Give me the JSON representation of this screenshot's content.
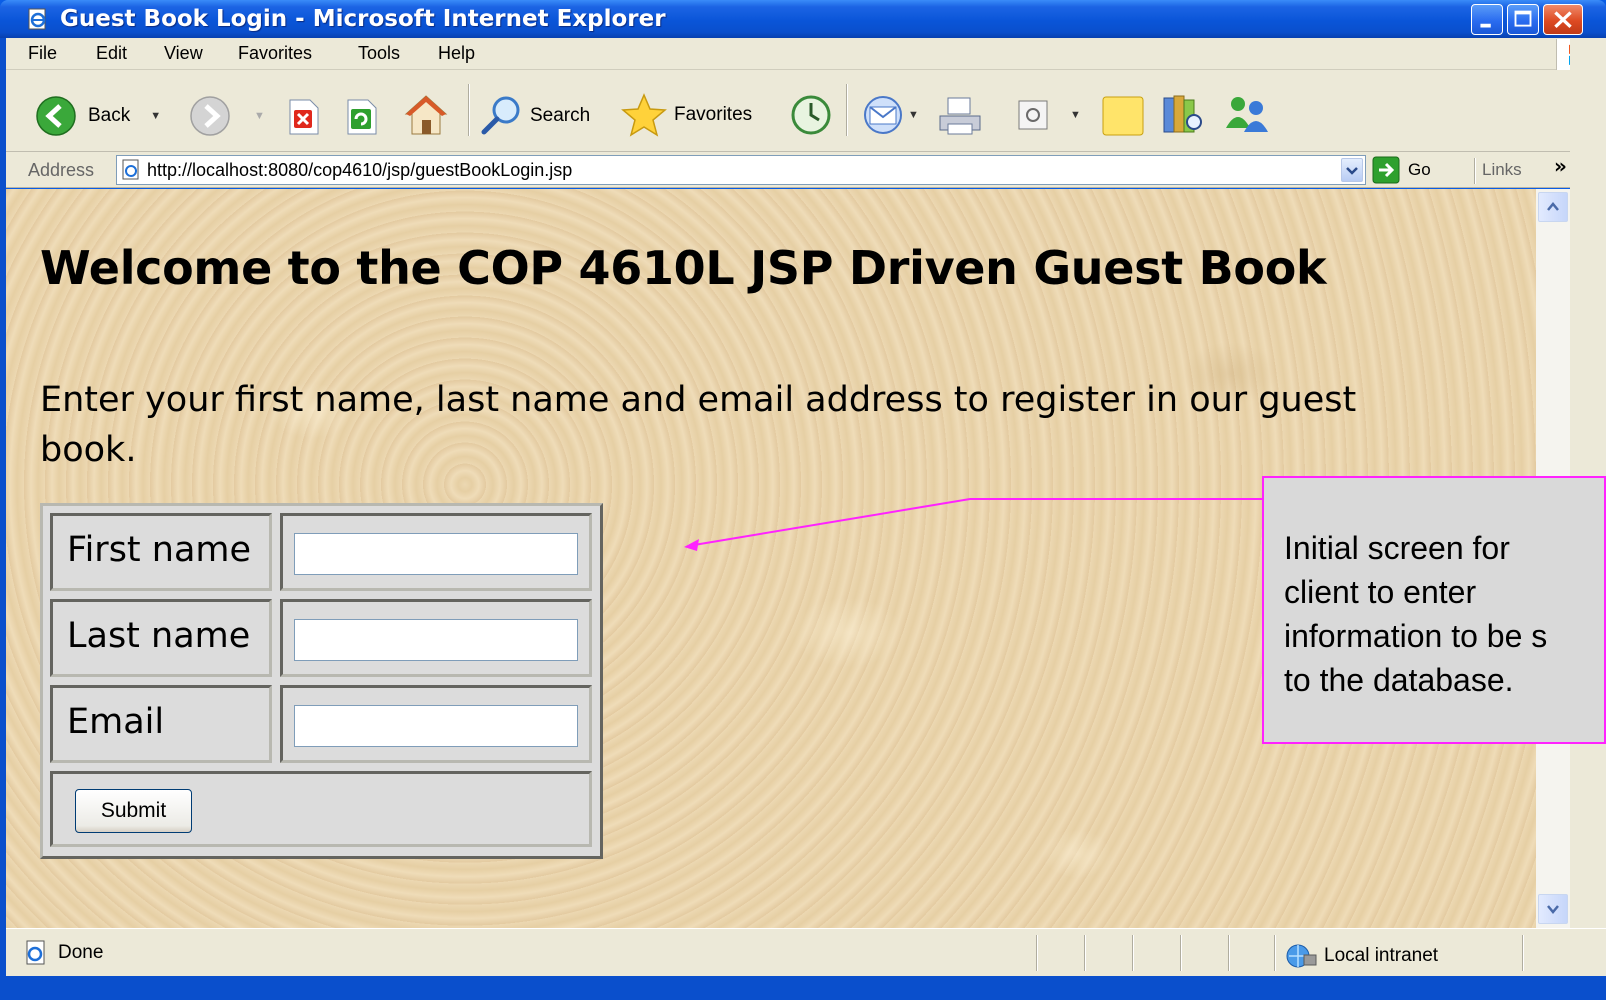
{
  "window": {
    "title": "Guest Book Login - Microsoft Internet Explorer",
    "accent": "#0a55d8"
  },
  "menu": {
    "items": [
      "File",
      "Edit",
      "View",
      "Favorites",
      "Tools",
      "Help"
    ]
  },
  "toolbar": {
    "back_label": "Back",
    "search_label": "Search",
    "favorites_label": "Favorites"
  },
  "address": {
    "label": "Address",
    "url": "http://localhost:8080/cop4610/jsp/guestBookLogin.jsp",
    "go_label": "Go",
    "links_label": "Links",
    "links_chevron": "»"
  },
  "page": {
    "heading": "Welcome to the COP 4610L JSP Driven Guest Book",
    "intro_line1": "Enter your first name, last name and email address to register in our guest",
    "intro_line2": "book.",
    "form": {
      "first_name_label": "First name",
      "first_name_value": "",
      "last_name_label": "Last name",
      "last_name_value": "",
      "email_label": "Email",
      "email_value": "",
      "submit_label": "Submit"
    }
  },
  "status": {
    "text": "Done",
    "zone": "Local intranet"
  },
  "callout": {
    "lines": [
      "Initial screen for",
      "client to enter",
      "information to be s",
      "to the database."
    ],
    "border_color": "#ff22ff"
  }
}
